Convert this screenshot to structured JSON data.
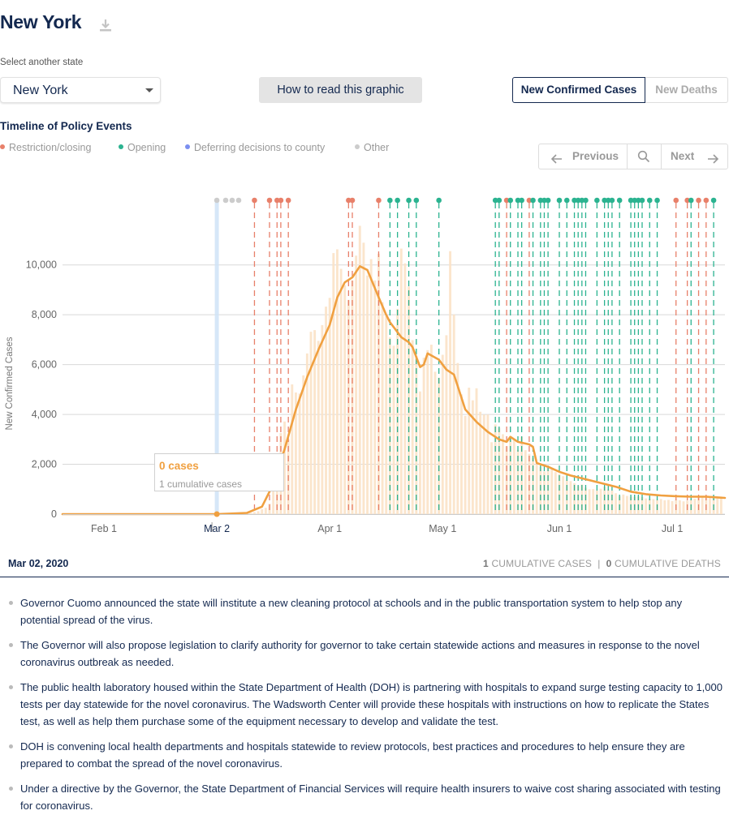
{
  "header": {
    "title": "New York",
    "download_icon": "download-icon"
  },
  "state_selector": {
    "label": "Select another state",
    "value": "New York"
  },
  "how_to_button": {
    "label": "How to read this graphic"
  },
  "metric_toggle": {
    "cases_label": "New Confirmed Cases",
    "deaths_label": "New Deaths",
    "active": "cases"
  },
  "timeline": {
    "title": "Timeline of Policy Events",
    "legend": [
      {
        "label": "Restriction/closing",
        "color": "#e8806a"
      },
      {
        "label": "Opening",
        "color": "#2bb390"
      },
      {
        "label": "Deferring decisions to county",
        "color": "#7b8ff0"
      },
      {
        "label": "Other",
        "color": "#cccccc"
      }
    ]
  },
  "nav": {
    "previous_label": "Previous",
    "next_label": "Next",
    "search_icon": "search-icon"
  },
  "chart_data": {
    "type": "bar",
    "ylabel": "New Confirmed Cases",
    "ylim": [
      0,
      11000
    ],
    "yticks": [
      0,
      2000,
      4000,
      6000,
      8000,
      10000
    ],
    "ytick_labels": [
      "0",
      "2,000",
      "4,000",
      "6,000",
      "8,000",
      "10,000"
    ],
    "xdate_range": [
      "2020-01-21",
      "2020-07-15"
    ],
    "xticks": [
      {
        "date": "2020-02-01",
        "label": "Feb 1"
      },
      {
        "date": "2020-03-02",
        "label": "Mar 2"
      },
      {
        "date": "2020-04-01",
        "label": "Apr 1"
      },
      {
        "date": "2020-05-01",
        "label": "May 1"
      },
      {
        "date": "2020-06-01",
        "label": "Jun 1"
      },
      {
        "date": "2020-07-01",
        "label": "Jul 1"
      }
    ],
    "selected_date": "2020-03-02",
    "daily_cases_start": "2020-03-01",
    "daily_cases": [
      0,
      1,
      0,
      1,
      2,
      4,
      21,
      16,
      34,
      32,
      45,
      79,
      116,
      202,
      253,
      419,
      1089,
      2019,
      3254,
      3716,
      3001,
      5205,
      4881,
      4841,
      5568,
      6448,
      7319,
      7385,
      6953,
      7585,
      8327,
      8679,
      10477,
      10627,
      9844,
      9187,
      8599,
      9383,
      10374,
      11571,
      10893,
      9578,
      10235,
      9378,
      10453,
      8505,
      7940,
      7090,
      6757,
      8236,
      10657,
      10064,
      9134,
      6983,
      6346,
      4923,
      6278,
      6581,
      6800,
      5714,
      5474,
      6394,
      7179,
      10553,
      8014,
      6064,
      4805,
      3942,
      5075,
      4567,
      5050,
      4108,
      3998,
      4002,
      2886,
      3599,
      3458,
      3206,
      2720,
      3057,
      2988,
      2576,
      3108,
      2567,
      2419,
      2265,
      1982,
      1900,
      1710,
      1879,
      1847,
      1686,
      1612,
      1522,
      1359,
      1327,
      1243,
      1125,
      1186,
      1059,
      997,
      1005,
      943,
      1021,
      1102,
      989,
      948,
      838,
      723,
      786,
      731,
      703,
      698,
      715,
      683,
      629,
      614,
      603,
      569,
      607,
      556,
      572,
      521,
      578,
      553,
      512,
      542,
      580,
      617,
      709,
      713,
      687,
      703,
      728,
      674,
      649
    ],
    "avg_points": [
      [
        "2020-01-21",
        0
      ],
      [
        "2020-03-02",
        0
      ],
      [
        "2020-03-10",
        50
      ],
      [
        "2020-03-14",
        300
      ],
      [
        "2020-03-17",
        1200
      ],
      [
        "2020-03-20",
        2600
      ],
      [
        "2020-03-23",
        4200
      ],
      [
        "2020-03-26",
        5500
      ],
      [
        "2020-03-29",
        6600
      ],
      [
        "2020-04-01",
        7600
      ],
      [
        "2020-04-03",
        8700
      ],
      [
        "2020-04-05",
        9300
      ],
      [
        "2020-04-07",
        9500
      ],
      [
        "2020-04-09",
        9950
      ],
      [
        "2020-04-11",
        9800
      ],
      [
        "2020-04-14",
        8700
      ],
      [
        "2020-04-16",
        8000
      ],
      [
        "2020-04-17",
        7700
      ],
      [
        "2020-04-20",
        7100
      ],
      [
        "2020-04-22",
        6900
      ],
      [
        "2020-04-23",
        6700
      ],
      [
        "2020-04-25",
        5900
      ],
      [
        "2020-04-26",
        6000
      ],
      [
        "2020-04-27",
        6450
      ],
      [
        "2020-04-30",
        6200
      ],
      [
        "2020-05-02",
        5800
      ],
      [
        "2020-05-04",
        5600
      ],
      [
        "2020-05-07",
        4200
      ],
      [
        "2020-05-10",
        3700
      ],
      [
        "2020-05-13",
        3300
      ],
      [
        "2020-05-16",
        3000
      ],
      [
        "2020-05-18",
        2900
      ],
      [
        "2020-05-19",
        3100
      ],
      [
        "2020-05-21",
        2900
      ],
      [
        "2020-05-24",
        2800
      ],
      [
        "2020-05-25",
        2700
      ],
      [
        "2020-05-26",
        2050
      ],
      [
        "2020-05-29",
        1900
      ],
      [
        "2020-06-01",
        1700
      ],
      [
        "2020-06-04",
        1550
      ],
      [
        "2020-06-08",
        1400
      ],
      [
        "2020-06-12",
        1250
      ],
      [
        "2020-06-16",
        1100
      ],
      [
        "2020-06-20",
        900
      ],
      [
        "2020-06-24",
        800
      ],
      [
        "2020-06-28",
        750
      ],
      [
        "2020-07-02",
        720
      ],
      [
        "2020-07-06",
        700
      ],
      [
        "2020-07-10",
        700
      ],
      [
        "2020-07-15",
        650
      ]
    ],
    "events": [
      {
        "date": "2020-03-02",
        "type": "other"
      },
      {
        "date": "2020-03-12",
        "type": "restriction"
      },
      {
        "date": "2020-03-16",
        "type": "restriction"
      },
      {
        "date": "2020-03-18",
        "type": "restriction"
      },
      {
        "date": "2020-03-19",
        "type": "restriction"
      },
      {
        "date": "2020-03-21",
        "type": "restriction"
      },
      {
        "date": "2020-04-06",
        "type": "restriction"
      },
      {
        "date": "2020-04-07",
        "type": "restriction"
      },
      {
        "date": "2020-04-14",
        "type": "restriction"
      },
      {
        "date": "2020-04-17",
        "type": "opening"
      },
      {
        "date": "2020-04-19",
        "type": "opening"
      },
      {
        "date": "2020-04-22",
        "type": "opening"
      },
      {
        "date": "2020-04-24",
        "type": "opening"
      },
      {
        "date": "2020-04-30",
        "type": "opening"
      },
      {
        "date": "2020-05-15",
        "type": "opening"
      },
      {
        "date": "2020-05-16",
        "type": "opening"
      },
      {
        "date": "2020-05-18",
        "type": "restriction"
      },
      {
        "date": "2020-05-19",
        "type": "opening"
      },
      {
        "date": "2020-05-21",
        "type": "opening"
      },
      {
        "date": "2020-05-22",
        "type": "opening"
      },
      {
        "date": "2020-05-24",
        "type": "restriction"
      },
      {
        "date": "2020-05-25",
        "type": "opening"
      },
      {
        "date": "2020-05-27",
        "type": "opening"
      },
      {
        "date": "2020-05-28",
        "type": "opening"
      },
      {
        "date": "2020-05-29",
        "type": "opening"
      },
      {
        "date": "2020-06-01",
        "type": "opening"
      },
      {
        "date": "2020-06-03",
        "type": "opening"
      },
      {
        "date": "2020-06-05",
        "type": "opening"
      },
      {
        "date": "2020-06-06",
        "type": "opening"
      },
      {
        "date": "2020-06-07",
        "type": "opening"
      },
      {
        "date": "2020-06-08",
        "type": "opening"
      },
      {
        "date": "2020-06-11",
        "type": "opening"
      },
      {
        "date": "2020-06-13",
        "type": "opening"
      },
      {
        "date": "2020-06-14",
        "type": "opening"
      },
      {
        "date": "2020-06-15",
        "type": "opening"
      },
      {
        "date": "2020-06-17",
        "type": "opening"
      },
      {
        "date": "2020-06-20",
        "type": "opening"
      },
      {
        "date": "2020-06-21",
        "type": "opening"
      },
      {
        "date": "2020-06-22",
        "type": "opening"
      },
      {
        "date": "2020-06-23",
        "type": "opening"
      },
      {
        "date": "2020-06-25",
        "type": "opening"
      },
      {
        "date": "2020-06-27",
        "type": "opening"
      },
      {
        "date": "2020-07-02",
        "type": "restriction"
      },
      {
        "date": "2020-07-05",
        "type": "restriction"
      },
      {
        "date": "2020-07-06",
        "type": "opening"
      },
      {
        "date": "2020-07-08",
        "type": "restriction"
      },
      {
        "date": "2020-07-10",
        "type": "restriction"
      },
      {
        "date": "2020-07-12",
        "type": "opening"
      }
    ]
  },
  "tooltip": {
    "cases": "0 cases",
    "cumulative": "1 cumulative cases"
  },
  "date_summary": {
    "date": "Mar 02, 2020",
    "cum_cases_count": "1",
    "cum_cases_label": "CUMULATIVE CASES",
    "cum_deaths_count": "0",
    "cum_deaths_label": "CUMULATIVE DEATHS",
    "separator": "|"
  },
  "events_list": [
    "Governor Cuomo announced the state will institute a new cleaning protocol at schools and in the public transportation system to help stop any potential spread of the virus.",
    "The Governor will also propose legislation to clarify authority for governor to take certain statewide actions and measures in response to the novel coronavirus outbreak as needed.",
    "The public health laboratory housed within the State Department of Health (DOH) is partnering with hospitals to expand surge testing capacity to 1,000 tests per day statewide for the novel coronavirus. The Wadsworth Center will provide these hospitals with instructions on how to replicate the States test, as well as help them purchase some of the equipment necessary to develop and validate the test.",
    "DOH is convening local health departments and hospitals statewide to review protocols, best practices and procedures to help ensure they are prepared to combat the spread of the novel coronavirus.",
    "Under a directive by the Governor, the State Department of Financial Services will require health insurers to waive cost sharing associated with testing for coronavirus."
  ]
}
